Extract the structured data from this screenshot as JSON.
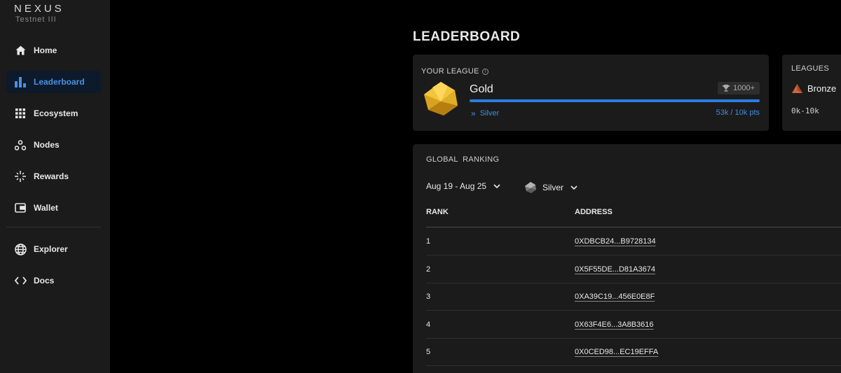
{
  "brand": {
    "name": "NEXUS",
    "subtitle": "Testnet III"
  },
  "sidebar": {
    "items": [
      {
        "label": "Home",
        "icon": "home-icon"
      },
      {
        "label": "Leaderboard",
        "icon": "bar-chart-icon",
        "active": true
      },
      {
        "label": "Ecosystem",
        "icon": "grid-icon"
      },
      {
        "label": "Nodes",
        "icon": "nodes-icon"
      },
      {
        "label": "Rewards",
        "icon": "sparkle-icon"
      },
      {
        "label": "Wallet",
        "icon": "wallet-icon"
      },
      {
        "label": "Explorer",
        "icon": "globe-icon"
      },
      {
        "label": "Docs",
        "icon": "code-icon"
      }
    ]
  },
  "page": {
    "title": "LEADERBOARD"
  },
  "your_league": {
    "label": "YOUR LEAGUE",
    "name": "Gold",
    "badge": "1000+",
    "next_league": "Silver",
    "points": "53k / 10k pts",
    "progress": 1.0
  },
  "leagues": {
    "label": "LEAGUES",
    "first_name": "Bronze",
    "first_range": "0k-10k"
  },
  "ranking": {
    "label": "GLOBAL  RANKING",
    "date_filter": "Aug 19 - Aug 25",
    "league_filter": "Silver",
    "columns": {
      "rank": "RANK",
      "address": "ADDRESS"
    },
    "rows": [
      {
        "rank": "1",
        "address": "0XDBCB24...B9728134"
      },
      {
        "rank": "2",
        "address": "0X5F55DE...D81A3674"
      },
      {
        "rank": "3",
        "address": "0XA39C19...456E0E8F"
      },
      {
        "rank": "4",
        "address": "0X63F4E6...3A8B3616"
      },
      {
        "rank": "5",
        "address": "0X0CED98...EC19EFFA"
      }
    ]
  },
  "colors": {
    "accent": "#2a7de1",
    "gold": "#e7b52c",
    "bronze": "#d2643a"
  }
}
